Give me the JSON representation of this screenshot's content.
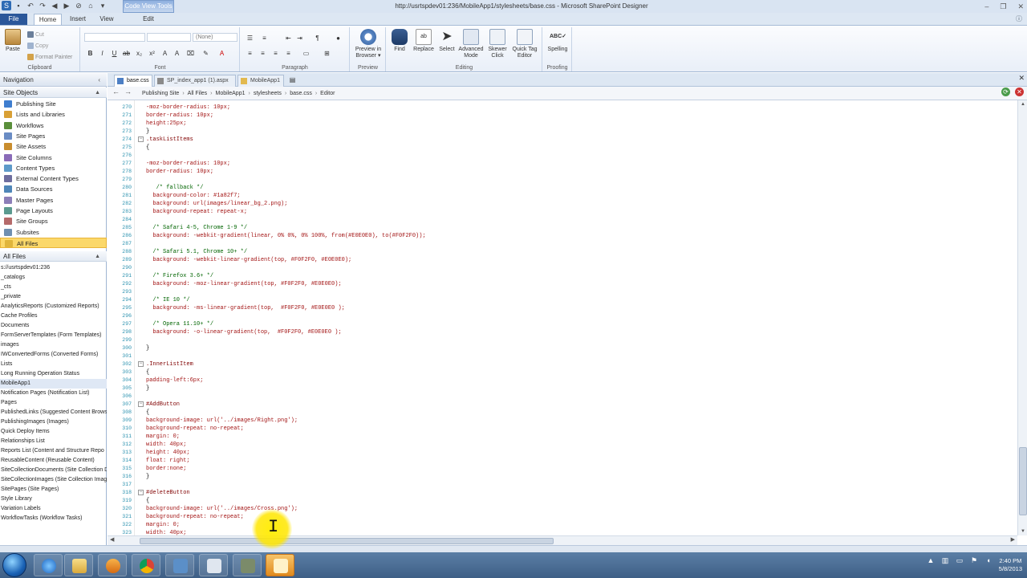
{
  "window": {
    "title": "http://usrtspdev01:236/MobileApp1/stylesheets/base.css - Microsoft SharePoint Designer",
    "contextual_tab": "Code View Tools"
  },
  "ribbon_tabs": {
    "file": "File",
    "home": "Home",
    "insert": "Insert",
    "view": "View",
    "edit": "Edit"
  },
  "clipboard": {
    "paste": "Paste",
    "cut": "Cut",
    "copy": "Copy",
    "format_painter": "Format Painter",
    "group": "Clipboard"
  },
  "font": {
    "style_value": "(None)",
    "group": "Font"
  },
  "paragraph": {
    "group": "Paragraph"
  },
  "preview": {
    "preview_in_browser": "Preview in Browser ▾",
    "group": "Preview"
  },
  "editing": {
    "find": "Find",
    "replace": "Replace",
    "select": "Select",
    "advanced_mode": "Advanced Mode",
    "skewer_click": "Skewer Click",
    "quick_tag_editor": "Quick Tag Editor",
    "group": "Editing"
  },
  "proofing": {
    "spelling": "Spelling",
    "group": "Proofing"
  },
  "navigation": {
    "title": "Navigation",
    "site_objects_header": "Site Objects",
    "site_objects": [
      "Publishing Site",
      "Lists and Libraries",
      "Workflows",
      "Site Pages",
      "Site Assets",
      "Site Columns",
      "Content Types",
      "External Content Types",
      "Data Sources",
      "Master Pages",
      "Page Layouts",
      "Site Groups",
      "Subsites",
      "All Files"
    ],
    "all_files_header": "All Files",
    "files": [
      "s://usrtspdev01:236",
      "_catalogs",
      "_cts",
      "_private",
      "AnalyticsReports (Customized Reports)",
      "Cache Profiles",
      "Documents",
      "FormServerTemplates (Form Templates)",
      "images",
      "IWConvertedForms (Converted Forms)",
      "Lists",
      "Long Running Operation Status",
      "MobileApp1",
      "Notification Pages (Notification List)",
      "Pages",
      "PublishedLinks (Suggested Content Brows",
      "PublishingImages (Images)",
      "Quick Deploy Items",
      "Relationships List",
      "Reports List (Content and Structure Repo",
      "ReusableContent (Reusable Content)",
      "SiteCollectionDocuments (Site Collection D",
      "SiteCollectionImages (Site Collection Imag",
      "SitePages (Site Pages)",
      "Style Library",
      "Variation Labels",
      "WorkflowTasks (Workflow Tasks)"
    ]
  },
  "doc_tabs": [
    "base.css",
    "SP_index_app1 (1).aspx",
    "MobileApp1"
  ],
  "breadcrumb": [
    "Publishing Site",
    "All Files",
    "MobileApp1",
    "stylesheets",
    "base.css",
    "Editor"
  ],
  "code_lines": [
    {
      "n": "270",
      "t": "-moz-border-radius: 10px;"
    },
    {
      "n": "271",
      "t": "border-radius: 10px;"
    },
    {
      "n": "272",
      "t": "height:25px;"
    },
    {
      "n": "273",
      "t": "}"
    },
    {
      "n": "274",
      "t": ".taskListItems"
    },
    {
      "n": "275",
      "t": "{"
    },
    {
      "n": "276",
      "t": ""
    },
    {
      "n": "277",
      "t": "-moz-border-radius: 10px;"
    },
    {
      "n": "278",
      "t": "border-radius: 10px;"
    },
    {
      "n": "279",
      "t": ""
    },
    {
      "n": "280",
      "t": "   /* fallback */"
    },
    {
      "n": "281",
      "t": "  background-color: #1a82f7;"
    },
    {
      "n": "282",
      "t": "  background: url(images/linear_bg_2.png);"
    },
    {
      "n": "283",
      "t": "  background-repeat: repeat-x;"
    },
    {
      "n": "284",
      "t": ""
    },
    {
      "n": "285",
      "t": "  /* Safari 4-5, Chrome 1-9 */"
    },
    {
      "n": "286",
      "t": "  background: -webkit-gradient(linear, 0% 0%, 0% 100%, from(#E0E0E0), to(#F0F2F0));"
    },
    {
      "n": "287",
      "t": ""
    },
    {
      "n": "288",
      "t": "  /* Safari 5.1, Chrome 10+ */"
    },
    {
      "n": "289",
      "t": "  background: -webkit-linear-gradient(top, #F0F2F0, #E0E0E0);"
    },
    {
      "n": "290",
      "t": ""
    },
    {
      "n": "291",
      "t": "  /* Firefox 3.6+ */"
    },
    {
      "n": "292",
      "t": "  background: -moz-linear-gradient(top, #F0F2F0, #E0E0E0);"
    },
    {
      "n": "293",
      "t": ""
    },
    {
      "n": "294",
      "t": "  /* IE 10 */"
    },
    {
      "n": "295",
      "t": "  background: -ms-linear-gradient(top,  #F0F2F0, #E0E0E0 );"
    },
    {
      "n": "296",
      "t": ""
    },
    {
      "n": "297",
      "t": "  /* Opera 11.10+ */"
    },
    {
      "n": "298",
      "t": "  background: -o-linear-gradient(top,  #F0F2F0, #E0E0E0 );"
    },
    {
      "n": "299",
      "t": ""
    },
    {
      "n": "300",
      "t": "}"
    },
    {
      "n": "301",
      "t": ""
    },
    {
      "n": "302",
      "t": ".InnerListItem"
    },
    {
      "n": "303",
      "t": "{"
    },
    {
      "n": "304",
      "t": "padding-left:6px;"
    },
    {
      "n": "305",
      "t": "}"
    },
    {
      "n": "306",
      "t": ""
    },
    {
      "n": "307",
      "t": "#AddButton"
    },
    {
      "n": "308",
      "t": "{"
    },
    {
      "n": "309",
      "t": "background-image: url('../images/Right.png');"
    },
    {
      "n": "310",
      "t": "background-repeat: no-repeat;"
    },
    {
      "n": "311",
      "t": "margin: 0;"
    },
    {
      "n": "312",
      "t": "width: 40px;"
    },
    {
      "n": "313",
      "t": "height: 40px;"
    },
    {
      "n": "314",
      "t": "float: right;"
    },
    {
      "n": "315",
      "t": "border:none;"
    },
    {
      "n": "316",
      "t": "}"
    },
    {
      "n": "317",
      "t": ""
    },
    {
      "n": "318",
      "t": "#deleteButton"
    },
    {
      "n": "319",
      "t": "{"
    },
    {
      "n": "320",
      "t": "background-image: url('../images/Cross.png');"
    },
    {
      "n": "321",
      "t": "background-repeat: no-repeat;"
    },
    {
      "n": "322",
      "t": "margin: 0;"
    },
    {
      "n": "323",
      "t": "width: 40px;"
    }
  ],
  "clock": {
    "time": "2:40 PM",
    "date": "5/8/2013"
  },
  "colors": {
    "accent": "#2b579a",
    "selection": "#fbd86a",
    "line_numbers": "#2b91af",
    "taskbar": "#4a6d96"
  }
}
